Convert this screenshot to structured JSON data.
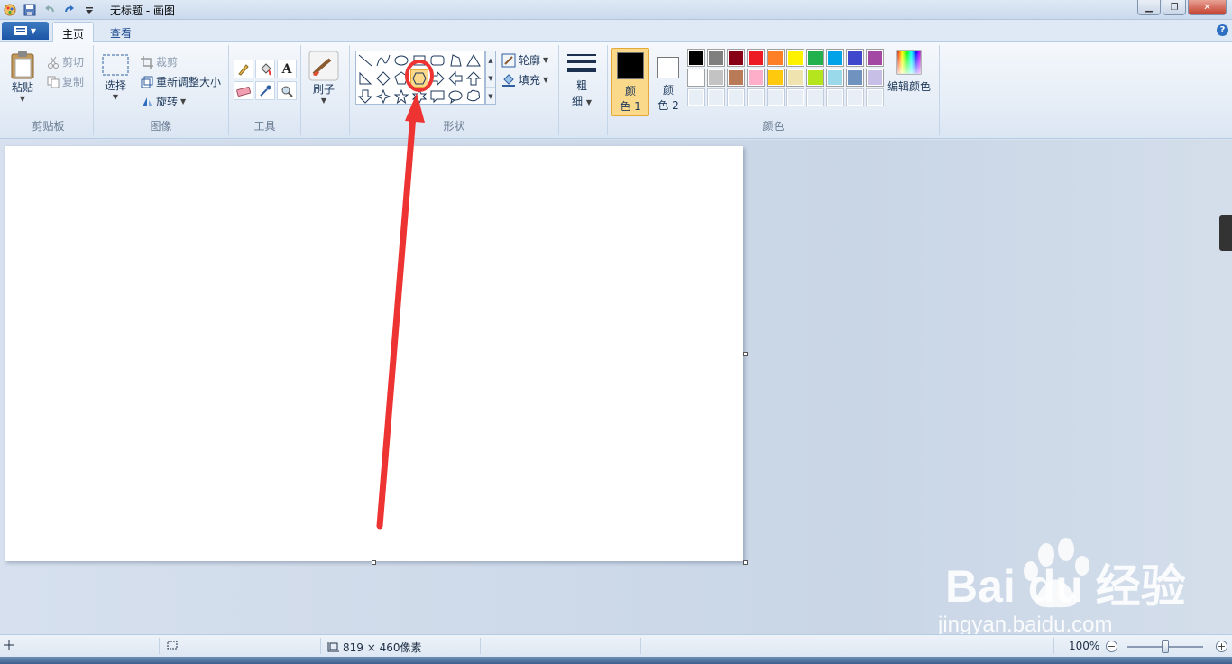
{
  "window": {
    "title": "无标题 - 画图"
  },
  "tabs": [
    {
      "label": "主页"
    },
    {
      "label": "查看"
    }
  ],
  "clipboard": {
    "paste": "粘贴",
    "cut": "剪切",
    "copy": "复制",
    "group": "剪贴板"
  },
  "image": {
    "select": "选择",
    "crop": "裁剪",
    "resize": "重新调整大小",
    "rotate": "旋转",
    "group": "图像"
  },
  "tools": {
    "group": "工具"
  },
  "brushes": {
    "label": "刷子"
  },
  "shapes": {
    "outline": "轮廓",
    "fill": "填充",
    "group": "形状",
    "selected_shape": "hexagon"
  },
  "size": {
    "line1": "粗",
    "line2": "细"
  },
  "colors": {
    "color1_line1": "颜",
    "color1_line2": "色 1",
    "color2_line1": "颜",
    "color2_line2": "色 2",
    "edit": "编辑颜色",
    "group": "颜色",
    "palette": [
      "#000000",
      "#7f7f7f",
      "#880015",
      "#ed1c24",
      "#ff7f27",
      "#fff200",
      "#22b14c",
      "#00a2e8",
      "#3f48cc",
      "#a349a4",
      "#ffffff",
      "#c3c3c3",
      "#b97a57",
      "#ffaec9",
      "#ffc90e",
      "#efe4b0",
      "#b5e61d",
      "#99d9ea",
      "#7092be",
      "#c8bfe7"
    ],
    "color1_value": "#000000",
    "color2_value": "#ffffff"
  },
  "status": {
    "dimensions": "819 × 460像素",
    "zoom": "100%"
  },
  "watermark": {
    "brand": "Bai du 经验",
    "url": "jingyan.baidu.com"
  },
  "annotation_color": "#ee3333"
}
